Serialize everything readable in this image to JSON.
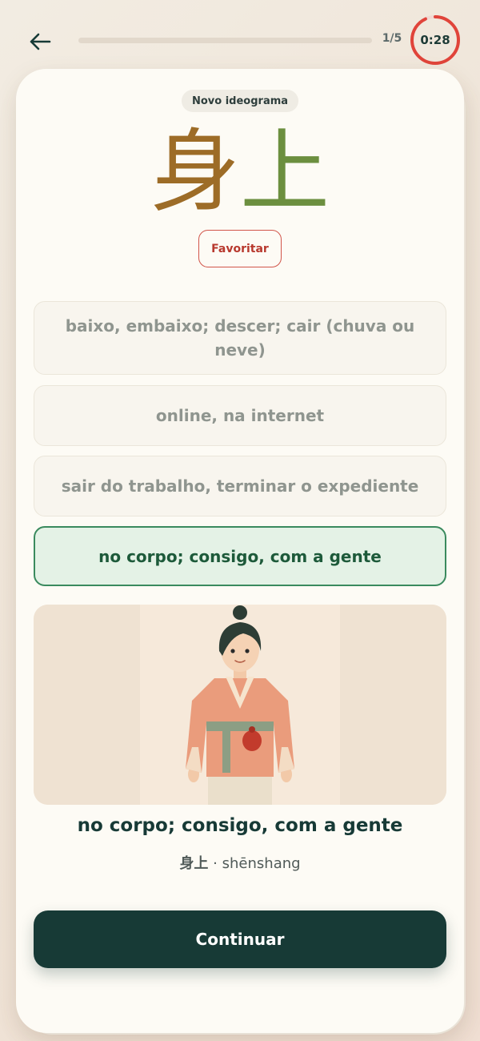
{
  "header": {
    "back_icon": "arrow-left-icon",
    "progress_fraction": 0.0,
    "step_count": "1/5",
    "timer": "0:28",
    "timer_remaining_fraction": 0.93,
    "timer_color": "#e0443a"
  },
  "card": {
    "badge": "Novo ideograma",
    "hanzi_char_1": "身",
    "hanzi_char_2": "上",
    "hanzi_colors": [
      "#9d6c27",
      "#6c8f3f"
    ],
    "favorite_label": "Favoritar"
  },
  "options": [
    {
      "label": "baixo, embaixo; descer; cair (chuva ou neve)",
      "state": "default"
    },
    {
      "label": "online, na internet",
      "state": "default"
    },
    {
      "label": "sair do trabalho, terminar o expediente",
      "state": "default"
    },
    {
      "label": "no corpo; consigo, com a gente",
      "state": "correct"
    }
  ],
  "result": {
    "meaning": "no corpo; consigo, com a gente",
    "hanzi": "身上",
    "separator": "·",
    "pinyin": "shēnshang"
  },
  "continue_label": "Continuar",
  "colors": {
    "accent_dark": "#173a36",
    "correct_bg": "#e4f2e6",
    "correct_border": "#3a8a5e",
    "favorite_red": "#b8392e"
  }
}
